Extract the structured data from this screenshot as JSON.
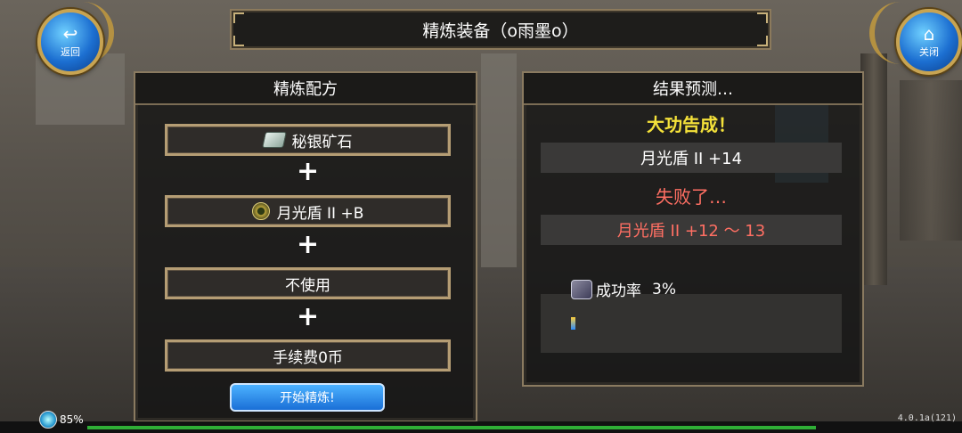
{
  "window": {
    "title": "精炼装备（o雨墨o）"
  },
  "nav": {
    "back": {
      "icon": "back-arrow-icon",
      "label": "返回"
    },
    "close": {
      "icon": "home-icon",
      "label": "关闭"
    }
  },
  "recipe": {
    "heading": "精炼配方",
    "material": "秘银矿石",
    "item": "月光盾 II  +B",
    "extra": "不使用",
    "fee": "手续费0币",
    "plus": "+",
    "start_button": "开始精炼!"
  },
  "prediction": {
    "heading": "结果预测…",
    "success_label": "大功告成！",
    "success_result": "月光盾 II  +14",
    "fail_label": "失败了…",
    "fail_result": "月光盾 II  +12 ～ 13",
    "rate_label": "成功率",
    "rate_value": "3%",
    "rate_fraction": 0.03
  },
  "status": {
    "battery": "85%",
    "version": "4.0.1a(121)"
  },
  "colors": {
    "success": "#f4e13a",
    "fail": "#ff6f63",
    "button": "#1a6fd7",
    "frame": "#8a7a60"
  }
}
